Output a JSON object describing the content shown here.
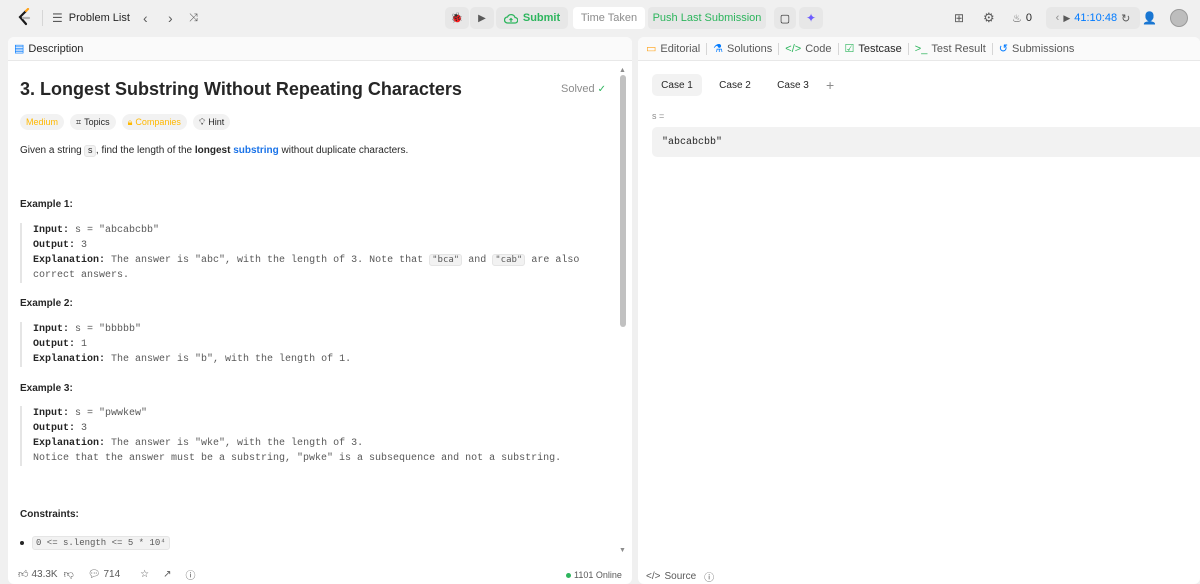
{
  "topbar": {
    "problem_list": "Problem List",
    "submit": "Submit",
    "time_taken": "Time Taken",
    "push_last": "Push Last Submission",
    "streak": "0",
    "timer": "41:10:48"
  },
  "left": {
    "tab_description": "Description",
    "title": "3. Longest Substring Without Repeating Characters",
    "solved": "Solved",
    "tags": [
      "Medium",
      "Topics",
      "Companies",
      "Hint"
    ],
    "desc": {
      "pre": "Given a string",
      "var": "s",
      "mid": ", find the length of the",
      "bold": "longest",
      "link": "substring",
      "post": "without duplicate characters."
    },
    "examples": [
      {
        "heading": "Example 1:",
        "input_label": "Input:",
        "input": "s = \"abcabcbb\"",
        "output_label": "Output:",
        "output": "3",
        "expl_label": "Explanation:",
        "expl_a": "The answer is \"abc\", with the length of 3. Note that",
        "code1": "\"bca\"",
        "and": "and",
        "code2": "\"cab\"",
        "expl_b": "are also",
        "expl_c": "correct answers."
      },
      {
        "heading": "Example 2:",
        "input_label": "Input:",
        "input": "s = \"bbbbb\"",
        "output_label": "Output:",
        "output": "1",
        "expl_label": "Explanation:",
        "expl_a": "The answer is \"b\", with the length of 1."
      },
      {
        "heading": "Example 3:",
        "input_label": "Input:",
        "input": "s = \"pwwkew\"",
        "output_label": "Output:",
        "output": "3",
        "expl_label": "Explanation:",
        "expl_a": "The answer is \"wke\", with the length of 3.",
        "expl_b": "Notice that the answer must be a substring, \"pwke\" is a subsequence and not a substring."
      }
    ],
    "constraints_heading": "Constraints:",
    "constraint_1": "0 <= s.length <= 5 * 10⁴",
    "likes": "43.3K",
    "comments": "714",
    "online": "1101 Online"
  },
  "right": {
    "tabs": [
      "Editorial",
      "Solutions",
      "Code",
      "Testcase",
      "Test Result",
      "Submissions"
    ],
    "cases": [
      "Case 1",
      "Case 2",
      "Case 3"
    ],
    "var_label": "s =",
    "var_value": "\"abcabcbb\"",
    "source": "Source"
  },
  "colors": {
    "accent_green": "#2db55d",
    "accent_blue": "#007aff",
    "medium": "#ffb800"
  }
}
